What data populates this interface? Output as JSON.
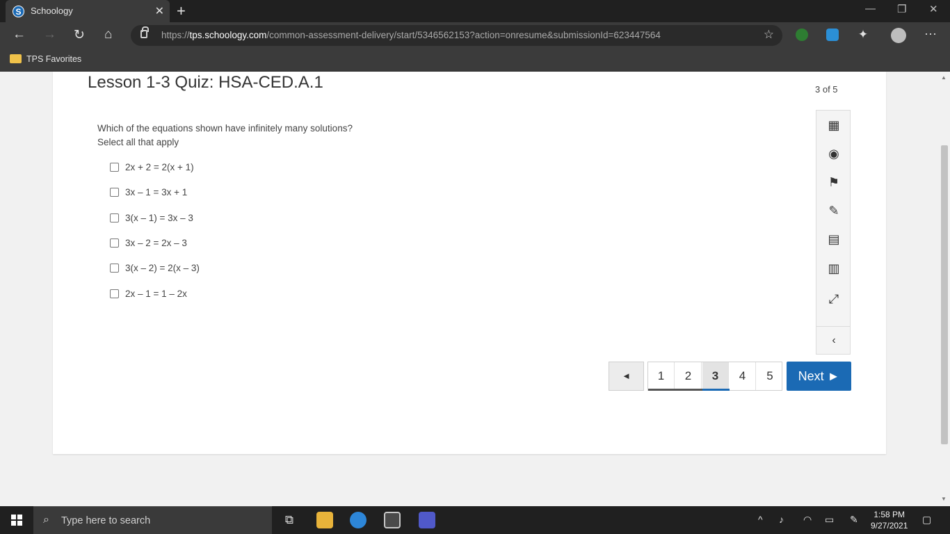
{
  "browser": {
    "tab_title": "Schoology",
    "favicon_letter": "S",
    "url_prefix": "https://",
    "url_host": "tps.schoology.com",
    "url_path": "/common-assessment-delivery/start/5346562153?action=onresume&submissionId=623447564",
    "favorites_folder": "TPS Favorites"
  },
  "quiz": {
    "title": "Lesson 1-3 Quiz: HSA-CED.A.1",
    "progress": "3 of 5",
    "question": "Which of the equations shown have infinitely many solutions?",
    "instruction": "Select all that apply",
    "options": [
      "2x + 2 = 2(x + 1)",
      "3x – 1 = 3x + 1",
      "3(x – 1) = 3x – 3",
      "3x – 2 = 2x – 3",
      "3(x – 2) = 2(x – 3)",
      "2x – 1 = 1 – 2x"
    ]
  },
  "pager": {
    "prev_symbol": "◄",
    "pages": [
      "1",
      "2",
      "3",
      "4",
      "5"
    ],
    "active_page": "3",
    "next_label": "Next ►"
  },
  "taskbar": {
    "search_placeholder": "Type here to search",
    "time": "1:58 PM",
    "date": "9/27/2021"
  },
  "colors": {
    "accent": "#1b6ab4",
    "tab_bg": "#202020"
  }
}
